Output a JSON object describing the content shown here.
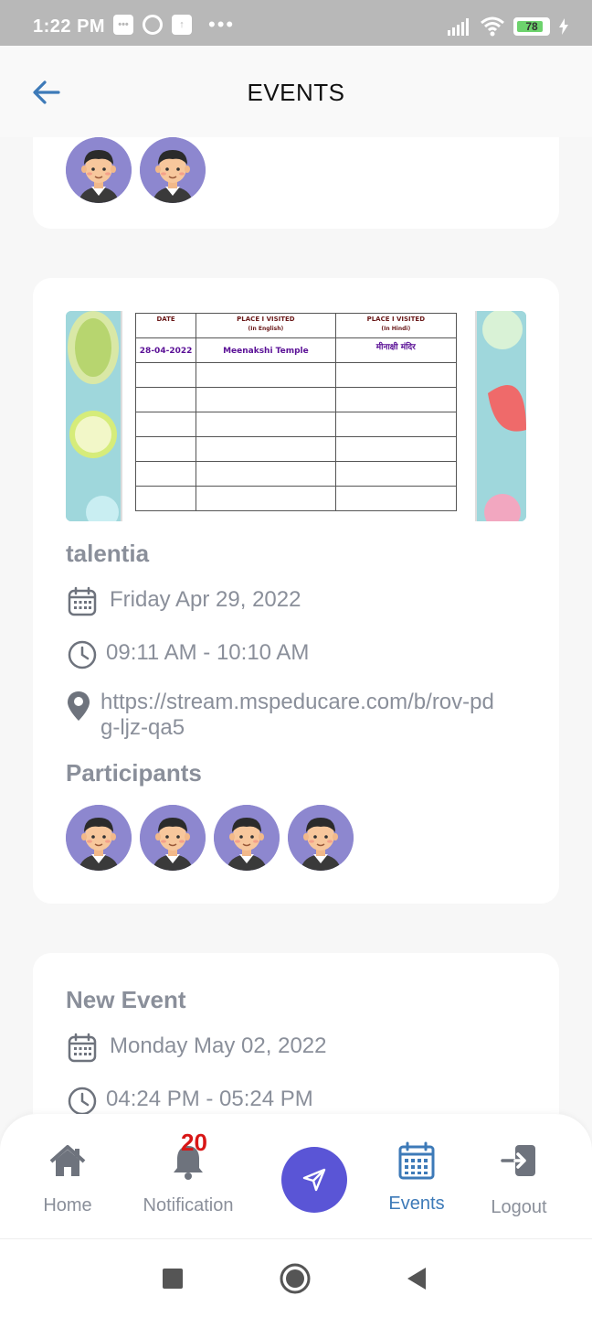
{
  "status_bar": {
    "time": "1:22 PM",
    "battery": "78",
    "icons": [
      "message-icon",
      "at-icon",
      "upload-icon",
      "more-icon",
      "signal-icon",
      "wifi-icon",
      "battery-icon",
      "charging-icon"
    ]
  },
  "header": {
    "title": "EVENTS",
    "back_icon": "arrow-left-icon",
    "accent": "#3d7ab8"
  },
  "events": [
    {
      "participants_count": 2
    },
    {
      "image": {
        "table_headers": [
          "DATE",
          "PLACE I VISITED",
          "PLACE I VISITED"
        ],
        "table_subheaders": [
          "",
          "(In English)",
          "(In Hindi)"
        ],
        "row": [
          "28-04-2022",
          "Meenakshi Temple",
          "मीनाक्षी मंदिर"
        ]
      },
      "title": "talentia",
      "date": "Friday Apr 29, 2022",
      "time": "09:11 AM - 10:10 AM",
      "location": "https://stream.mspeducare.com/b/rov-pdg-ljz-qa5",
      "participants_label": "Participants",
      "participants_count": 4
    },
    {
      "title": "New Event",
      "date": "Monday May 02, 2022",
      "time": "04:24 PM - 05:24 PM"
    }
  ],
  "bottom_nav": {
    "home": "Home",
    "notification": "Notification",
    "notification_badge": "20",
    "events": "Events",
    "logout": "Logout",
    "fab_color": "#5a55d6",
    "active_color": "#3d7ab8",
    "badge_color": "#d81616"
  }
}
